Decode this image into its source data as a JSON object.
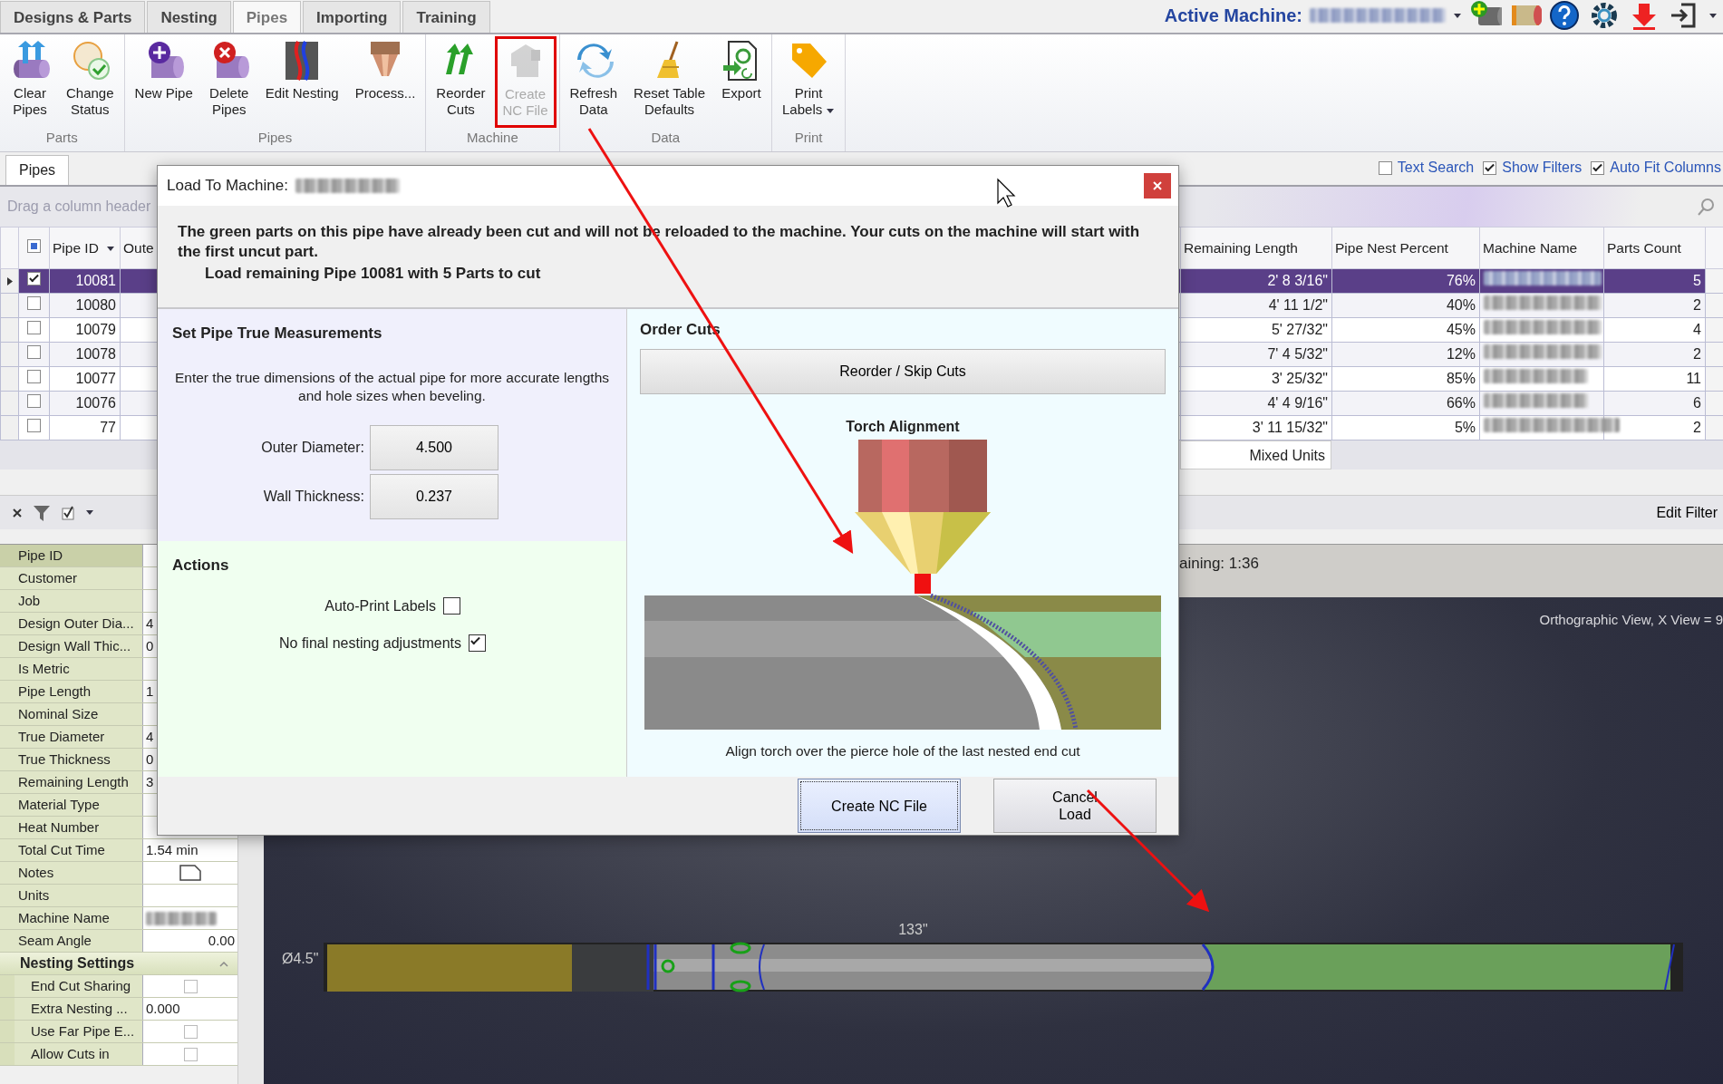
{
  "top_tabs": [
    {
      "label": "Designs & Parts",
      "selected": false
    },
    {
      "label": "Nesting",
      "selected": false
    },
    {
      "label": "Pipes",
      "selected": true
    },
    {
      "label": "Importing",
      "selected": false
    },
    {
      "label": "Training",
      "selected": false
    }
  ],
  "active_machine": {
    "label": "Active Machine:"
  },
  "ribbon": [
    {
      "label": "Parts",
      "buttons": [
        {
          "label": "Clear\nPipes",
          "disabled": false,
          "highlighted": false,
          "dropdown": false
        },
        {
          "label": "Change\nStatus",
          "disabled": false,
          "highlighted": false,
          "dropdown": false
        }
      ]
    },
    {
      "label": "Pipes",
      "buttons": [
        {
          "label": "New Pipe",
          "disabled": false,
          "highlighted": false,
          "dropdown": false
        },
        {
          "label": "Delete\nPipes",
          "disabled": false,
          "highlighted": false,
          "dropdown": false
        },
        {
          "label": "Edit Nesting",
          "disabled": false,
          "highlighted": false,
          "dropdown": false
        },
        {
          "label": "Process...",
          "disabled": false,
          "highlighted": false,
          "dropdown": false
        }
      ]
    },
    {
      "label": "Machine",
      "buttons": [
        {
          "label": "Reorder\nCuts",
          "disabled": false,
          "highlighted": false,
          "dropdown": false
        },
        {
          "label": "Create\nNC File",
          "disabled": true,
          "highlighted": true,
          "dropdown": false
        }
      ]
    },
    {
      "label": "Data",
      "buttons": [
        {
          "label": "Refresh\nData",
          "disabled": false,
          "highlighted": false,
          "dropdown": false
        },
        {
          "label": "Reset Table\nDefaults",
          "disabled": false,
          "highlighted": false,
          "dropdown": false
        },
        {
          "label": "Export",
          "disabled": false,
          "highlighted": false,
          "dropdown": false
        }
      ]
    },
    {
      "label": "Print",
      "buttons": [
        {
          "label": "Print\nLabels",
          "disabled": false,
          "highlighted": false,
          "dropdown": true
        }
      ]
    }
  ],
  "panel_tab": {
    "label": "Pipes",
    "selected": true
  },
  "grid_options": [
    {
      "label": "Text Search",
      "checked": false
    },
    {
      "label": "Show Filters",
      "checked": true
    },
    {
      "label": "Auto Fit Columns",
      "checked": true
    }
  ],
  "group_panel_hint": "Drag a column header",
  "grid": {
    "select_all": {
      "indeterminate": true
    },
    "columns": [
      "Pipe ID",
      "Oute",
      "Remaining Length",
      "Pipe Nest Percent",
      "Machine Name",
      "Parts Count"
    ],
    "rows": [
      {
        "selected": true,
        "checked": true,
        "pipe_id": "10081",
        "remaining_length": "2' 8 3/16\"",
        "nest_percent": "76%",
        "parts_count": "5"
      },
      {
        "selected": false,
        "checked": false,
        "pipe_id": "10080",
        "remaining_length": "4' 11 1/2\"",
        "nest_percent": "40%",
        "parts_count": "2"
      },
      {
        "selected": false,
        "checked": false,
        "pipe_id": "10079",
        "remaining_length": "5' 27/32\"",
        "nest_percent": "45%",
        "parts_count": "4"
      },
      {
        "selected": false,
        "checked": false,
        "pipe_id": "10078",
        "remaining_length": "7' 4 5/32\"",
        "nest_percent": "12%",
        "parts_count": "2"
      },
      {
        "selected": false,
        "checked": false,
        "pipe_id": "10077",
        "remaining_length": "3' 25/32\"",
        "nest_percent": "85%",
        "parts_count": "11"
      },
      {
        "selected": false,
        "checked": false,
        "pipe_id": "10076",
        "remaining_length": "4' 4 9/16\"",
        "nest_percent": "66%",
        "parts_count": "6"
      },
      {
        "selected": false,
        "checked": false,
        "pipe_id": "77",
        "remaining_length": "3' 11 15/32\"",
        "nest_percent": "5%",
        "parts_count": "2"
      }
    ],
    "footer": "Mixed Units",
    "edit_filter": "Edit Filter"
  },
  "properties": [
    {
      "kind": "text",
      "label": "Pipe ID",
      "selected": true
    },
    {
      "kind": "text",
      "label": "Customer",
      "selected": false
    },
    {
      "kind": "text",
      "label": "Job",
      "selected": false
    },
    {
      "kind": "text",
      "label": "Design Outer Dia...",
      "value": "4",
      "selected": false
    },
    {
      "kind": "text",
      "label": "Design Wall Thic...",
      "value": "0",
      "selected": false
    },
    {
      "kind": "text",
      "label": "Is Metric",
      "selected": false
    },
    {
      "kind": "text",
      "label": "Pipe Length",
      "value": "1",
      "selected": false
    },
    {
      "kind": "text",
      "label": "Nominal Size",
      "selected": false
    },
    {
      "kind": "text",
      "label": "True Diameter",
      "value": "4",
      "selected": false
    },
    {
      "kind": "text",
      "label": "True Thickness",
      "value": "0",
      "selected": false
    },
    {
      "kind": "text",
      "label": "Remaining Length",
      "value": "3",
      "selected": false
    },
    {
      "kind": "text",
      "label": "Material Type",
      "selected": false
    },
    {
      "kind": "text",
      "label": "Heat Number",
      "selected": false
    },
    {
      "kind": "text",
      "label": "Total Cut Time",
      "value": "1.54 min",
      "selected": false
    },
    {
      "kind": "note",
      "label": "Notes",
      "selected": false
    },
    {
      "kind": "text",
      "label": "Units",
      "selected": false
    },
    {
      "kind": "redacted",
      "label": "Machine Name",
      "selected": false
    },
    {
      "kind": "number",
      "label": "Seam Angle",
      "value": "0.00",
      "selected": false
    }
  ],
  "property_category": {
    "label": "Nesting Settings",
    "expanded": true,
    "items": [
      {
        "kind": "checkbox",
        "label": "End Cut Sharing",
        "checked": false
      },
      {
        "kind": "text",
        "label": "Extra Nesting ...",
        "value": "0.000"
      },
      {
        "kind": "checkbox",
        "label": "Use Far Pipe E...",
        "checked": false
      },
      {
        "kind": "checkbox",
        "label": "Allow Cuts in",
        "checked": false
      }
    ]
  },
  "status": "aining: 1:36",
  "view": {
    "caption": "Orthographic View,  X View = 9",
    "diameter": "Ø4.5\"",
    "length": "133\""
  },
  "dialog": {
    "title": "Load To Machine:",
    "message": "The green parts on this pipe have already been cut and will not be reloaded to the machine. Your cuts on the machine will start with the first uncut part.",
    "summary": "Load remaining Pipe 10081 with 5 Parts to cut",
    "measurements": {
      "title": "Set Pipe True Measurements",
      "description": "Enter the true dimensions of the actual pipe for more accurate lengths and hole sizes when beveling.",
      "fields": [
        {
          "label": "Outer Diameter:",
          "value": "4.500"
        },
        {
          "label": "Wall Thickness:",
          "value": "0.237"
        }
      ]
    },
    "actions": {
      "title": "Actions",
      "options": [
        {
          "label": "Auto-Print Labels",
          "checked": false
        },
        {
          "label": "No final nesting adjustments",
          "checked": true
        }
      ]
    },
    "order": {
      "title": "Order Cuts",
      "button": "Reorder / Skip Cuts",
      "illustration_title": "Torch Alignment",
      "caption": "Align torch over the pierce hole of the last nested end cut"
    },
    "buttons": [
      {
        "label": "Create NC File",
        "default": true
      },
      {
        "label": "Cancel\nLoad",
        "default": false
      }
    ]
  }
}
